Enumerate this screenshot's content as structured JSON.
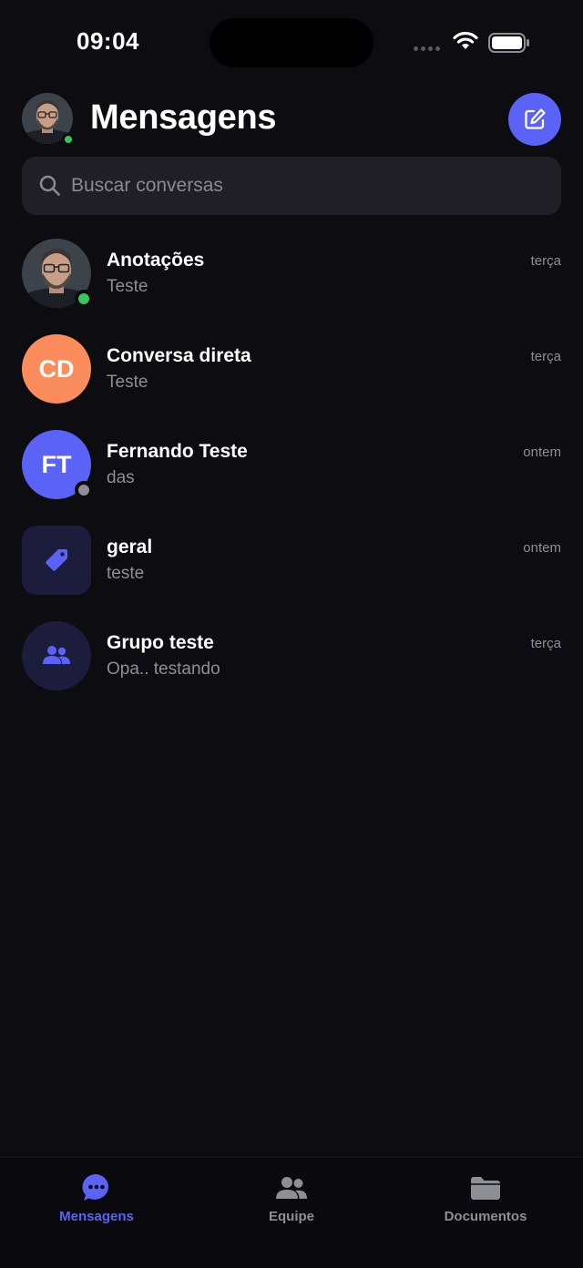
{
  "status_bar": {
    "time": "09:04"
  },
  "header": {
    "title": "Mensagens",
    "compose_icon": "compose-icon"
  },
  "search": {
    "placeholder": "Buscar conversas",
    "icon": "search-icon"
  },
  "conversations": [
    {
      "name": "Anotações",
      "preview": "Teste",
      "time": "terça",
      "avatar_type": "photo",
      "presence": "online"
    },
    {
      "name": "Conversa direta",
      "preview": "Teste",
      "time": "terça",
      "avatar_type": "initials",
      "initials": "CD",
      "avatar_color": "#fb8c5c"
    },
    {
      "name": "Fernando Teste",
      "preview": "das",
      "time": "ontem",
      "avatar_type": "initials",
      "initials": "FT",
      "avatar_color": "#5a63f5",
      "presence": "offline"
    },
    {
      "name": "geral",
      "preview": "teste",
      "time": "ontem",
      "avatar_type": "channel",
      "icon": "tag-icon"
    },
    {
      "name": "Grupo teste",
      "preview": "Opa.. testando",
      "time": "terça",
      "avatar_type": "group",
      "icon": "group-icon"
    }
  ],
  "tabs": [
    {
      "label": "Mensagens",
      "icon": "chat-bubble-icon",
      "active": true
    },
    {
      "label": "Equipe",
      "icon": "team-icon",
      "active": false
    },
    {
      "label": "Documentos",
      "icon": "folder-icon",
      "active": false
    }
  ],
  "colors": {
    "accent": "#5a63f5",
    "background": "#0c0c11",
    "online": "#34c759",
    "offline": "#8e8e93"
  }
}
